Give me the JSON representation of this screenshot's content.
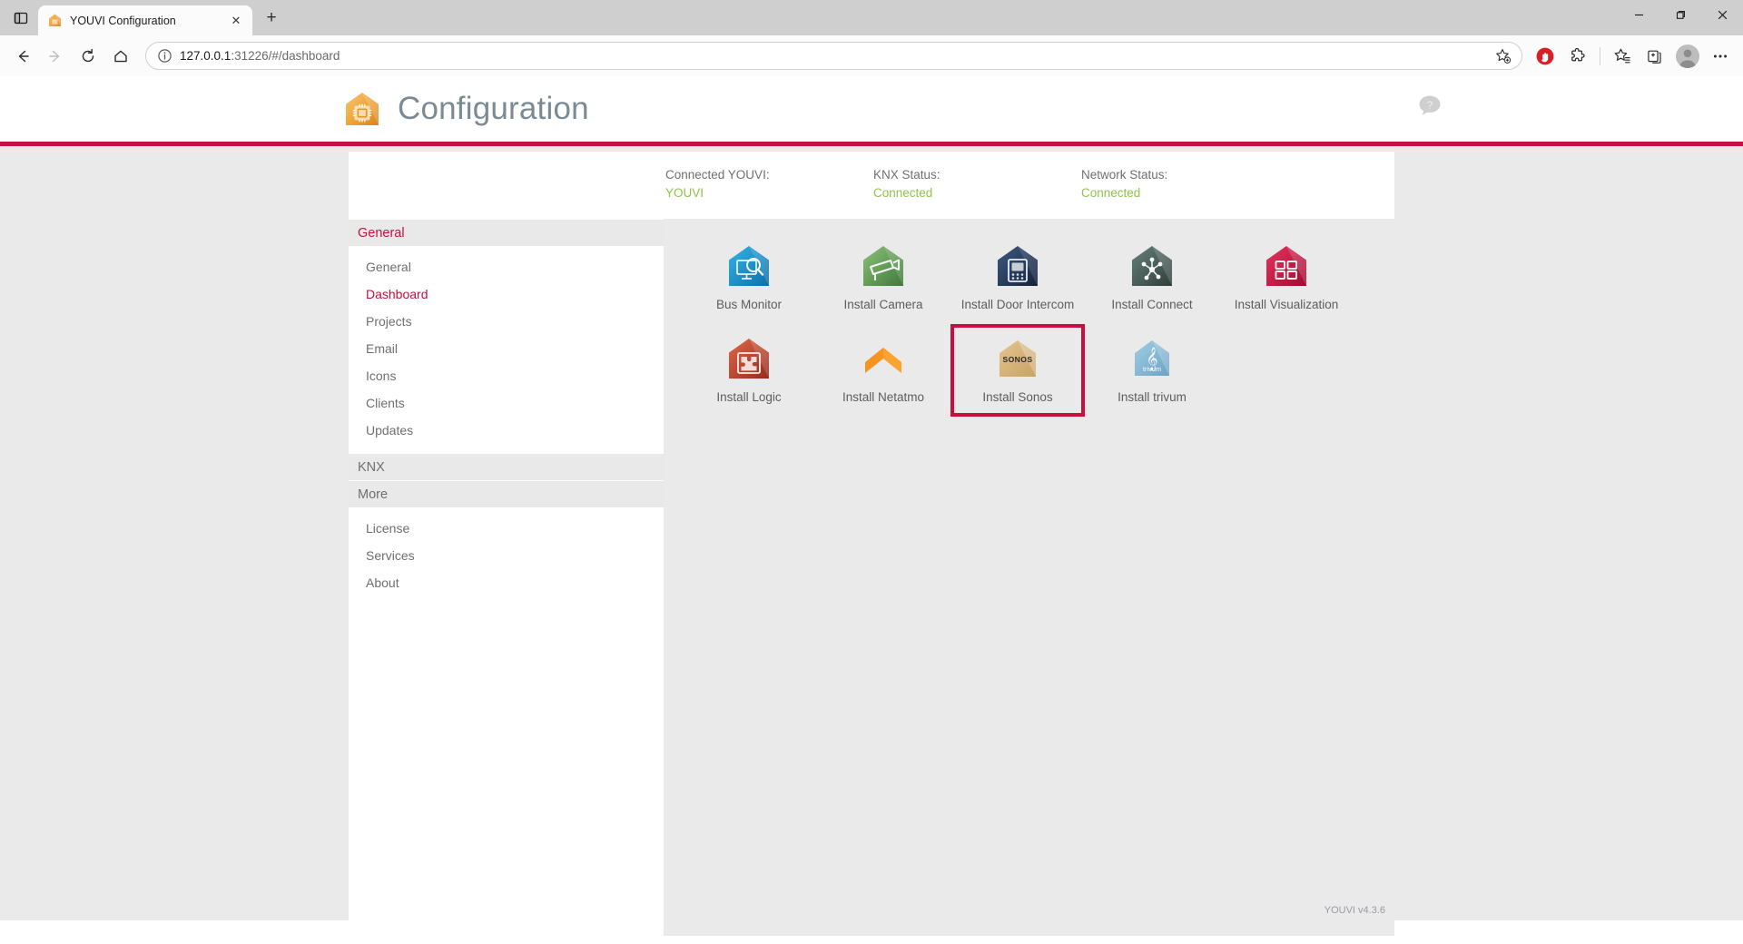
{
  "browser": {
    "tab_actions_icon": "split-panel-icon",
    "tab": {
      "title": "YOUVI Configuration",
      "favicon": "youvi-house-favicon",
      "close_label": "✕"
    },
    "new_tab_label": "+",
    "window_controls": {
      "minimize": "—",
      "maximize": "❐",
      "close": "✕"
    },
    "nav": {
      "back_icon": "back-arrow-icon",
      "forward_icon": "forward-arrow-icon",
      "refresh_icon": "reload-icon",
      "home_icon": "home-icon"
    },
    "address_bar": {
      "info_icon": "site-info-icon",
      "url_host": "127.0.0.1",
      "url_rest": ":31226/#/dashboard",
      "favorite_icon": "add-favorite-star-icon"
    },
    "toolbar_icons": [
      {
        "name": "adblock-icon",
        "color": "#d81f26"
      },
      {
        "name": "extensions-puzzle-icon",
        "color": "#2b2b2b"
      },
      {
        "name": "favorites-star-icon",
        "color": "#2b2b2b"
      },
      {
        "name": "collections-icon",
        "color": "#2b2b2b"
      },
      {
        "name": "profile-avatar",
        "color": "#bdbdbd"
      },
      {
        "name": "settings-more-icon",
        "color": "#2b2b2b"
      }
    ]
  },
  "app": {
    "title": "Configuration",
    "logo_icon": "youvi-house-chip-logo",
    "help_icon": "help-question-bubble-icon",
    "accent_color": "#c8103e",
    "title_color": "#7c8a94",
    "version": "YOUVI v4.3.6"
  },
  "status": [
    {
      "label": "Connected YOUVI:",
      "value": "YOUVI"
    },
    {
      "label": "KNX Status:",
      "value": "Connected"
    },
    {
      "label": "Network Status:",
      "value": "Connected"
    }
  ],
  "sidebar": {
    "groups": [
      {
        "header": "General",
        "active": true,
        "items": [
          {
            "label": "General",
            "selected": false
          },
          {
            "label": "Dashboard",
            "selected": true
          },
          {
            "label": "Projects",
            "selected": false
          },
          {
            "label": "Email",
            "selected": false
          },
          {
            "label": "Icons",
            "selected": false
          },
          {
            "label": "Clients",
            "selected": false
          },
          {
            "label": "Updates",
            "selected": false
          }
        ]
      },
      {
        "header": "KNX",
        "active": false,
        "items": []
      },
      {
        "header": "More",
        "active": false,
        "items": [
          {
            "label": "License",
            "selected": false
          },
          {
            "label": "Services",
            "selected": false
          },
          {
            "label": "About",
            "selected": false
          }
        ]
      }
    ]
  },
  "tiles": [
    {
      "label": "Bus Monitor",
      "icon": "bus-monitor-icon",
      "color": "#1a8fcd",
      "highlighted": false
    },
    {
      "label": "Install Camera",
      "icon": "camera-icon",
      "color": "#5f9e56",
      "highlighted": false
    },
    {
      "label": "Install Door Intercom",
      "icon": "door-intercom-icon",
      "color": "#1d3557",
      "highlighted": false
    },
    {
      "label": "Install Connect",
      "icon": "connect-network-icon",
      "color": "#4a5e57",
      "highlighted": false
    },
    {
      "label": "Install Visualization",
      "icon": "visualization-grid-icon",
      "color": "#c8103e",
      "highlighted": false
    },
    {
      "label": "Install Logic",
      "icon": "logic-puzzle-icon",
      "color": "#b03a2a",
      "highlighted": false
    },
    {
      "label": "Install Netatmo",
      "icon": "netatmo-chevron-icon",
      "color": "#f79420",
      "highlighted": false
    },
    {
      "label": "Install Sonos",
      "icon": "sonos-icon",
      "color": "#d6b074",
      "highlighted": true
    },
    {
      "label": "Install trivum",
      "icon": "trivum-clef-icon",
      "color": "#7fb4cf",
      "highlighted": false
    }
  ]
}
